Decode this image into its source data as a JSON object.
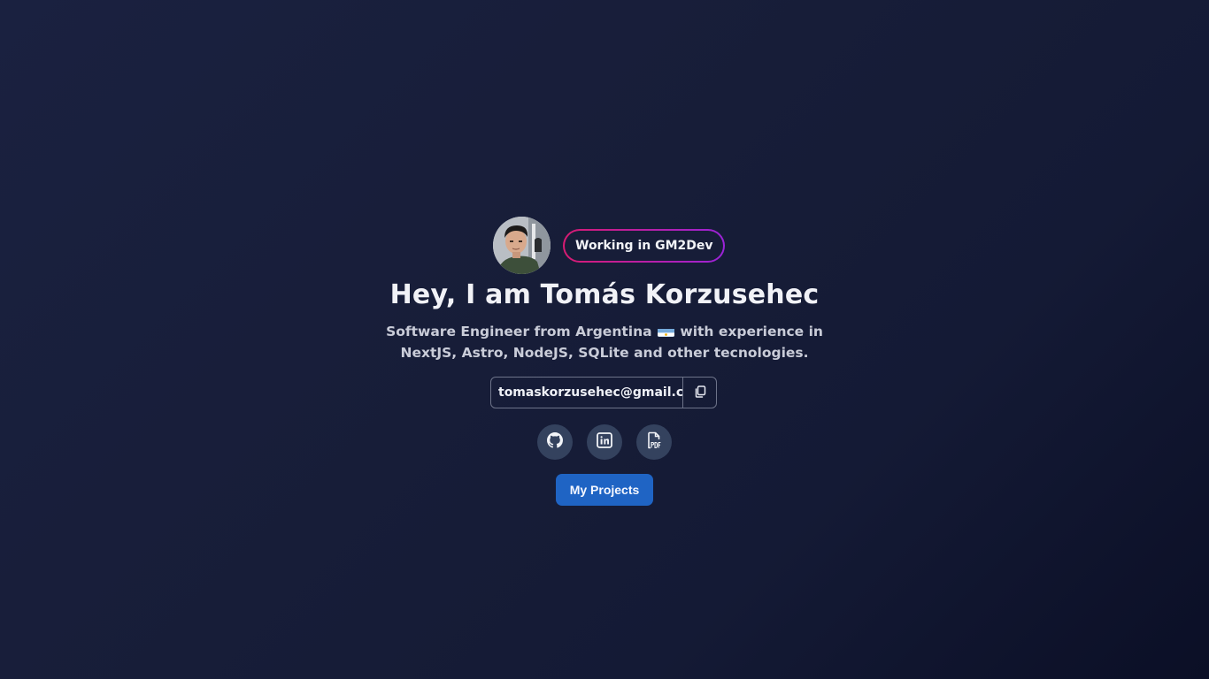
{
  "profile": {
    "badge": "Working in GM2Dev",
    "title": "Hey, I am Tomás Korzusehec",
    "subtitle_before_flag": "Software Engineer from Argentina",
    "subtitle_after_flag": "with experience in NextJS, Astro, NodeJS, SQLite and other tecnologies.",
    "email": "tomaskorzusehec@gmail.com"
  },
  "actions": {
    "projects_label": "My Projects"
  },
  "socials": [
    {
      "icon": "github-icon"
    },
    {
      "icon": "linkedin-icon"
    },
    {
      "icon": "pdf-icon"
    }
  ],
  "colors": {
    "accent": "#1f64c4",
    "badge_gradient_start": "#d81b72",
    "badge_gradient_end": "#9b23d8",
    "social_bg": "#34425e"
  }
}
